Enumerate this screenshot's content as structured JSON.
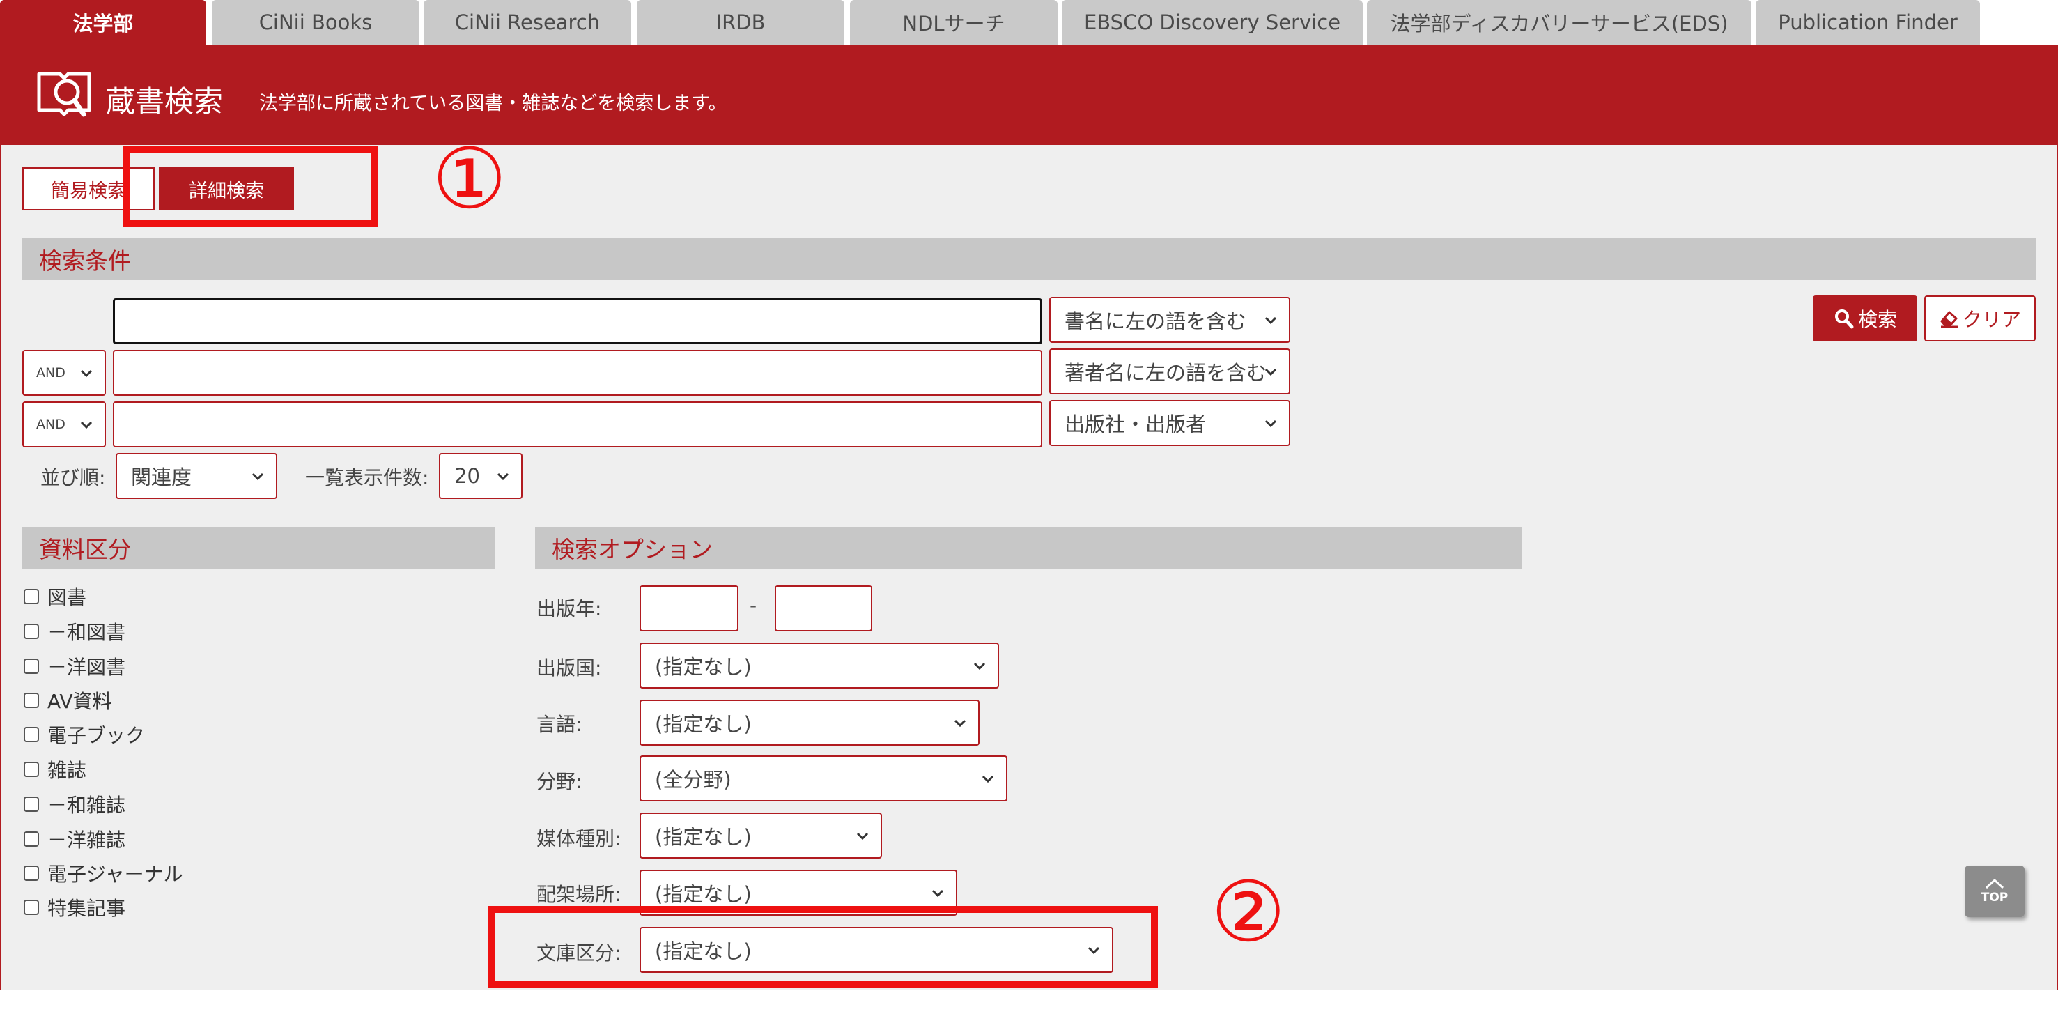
{
  "tabs": [
    {
      "label": "法学部",
      "active": true
    },
    {
      "label": "CiNii Books"
    },
    {
      "label": "CiNii Research"
    },
    {
      "label": "IRDB"
    },
    {
      "label": "NDLサーチ"
    },
    {
      "label": "EBSCO Discovery Service"
    },
    {
      "label": "法学部ディスカバリーサービス(EDS)"
    },
    {
      "label": "Publication Finder"
    }
  ],
  "header": {
    "title": "蔵書検索",
    "description": "法学部に所蔵されている図書・雑誌などを検索します。",
    "icon": "book-search-icon"
  },
  "mode": {
    "simple_label": "簡易検索",
    "detail_label": "詳細検索",
    "active": "detail"
  },
  "conditions": {
    "section_title": "検索条件",
    "rows": [
      {
        "value": "",
        "field": "書名に左の語を含む"
      },
      {
        "operator": "AND",
        "value": "",
        "field": "著者名に左の語を含む"
      },
      {
        "operator": "AND",
        "value": "",
        "field": "出版社・出版者"
      }
    ],
    "sort_label": "並び順:",
    "sort_value": "関連度",
    "per_page_label": "一覧表示件数:",
    "per_page_value": "20",
    "search_button": "検索",
    "clear_button": "クリア"
  },
  "material_types": {
    "section_title": "資料区分",
    "items": [
      {
        "label": "図書",
        "checked": false
      },
      {
        "label": "－和図書",
        "checked": false
      },
      {
        "label": "－洋図書",
        "checked": false
      },
      {
        "label": "AV資料",
        "checked": false
      },
      {
        "label": "電子ブック",
        "checked": false
      },
      {
        "label": "雑誌",
        "checked": false
      },
      {
        "label": "－和雑誌",
        "checked": false
      },
      {
        "label": "－洋雑誌",
        "checked": false
      },
      {
        "label": "電子ジャーナル",
        "checked": false
      },
      {
        "label": "特集記事",
        "checked": false
      }
    ]
  },
  "options": {
    "section_title": "検索オプション",
    "year_label": "出版年:",
    "year_from": "",
    "year_separator": "-",
    "year_to": "",
    "country_label": "出版国:",
    "country_value": "(指定なし)",
    "language_label": "言語:",
    "language_value": "(指定なし)",
    "field_label": "分野:",
    "field_value": "(全分野)",
    "media_label": "媒体種別:",
    "media_value": "(指定なし)",
    "location_label": "配架場所:",
    "location_value": "(指定なし)",
    "bunko_label": "文庫区分:",
    "bunko_value": "(指定なし)"
  },
  "annotations": {
    "marker_1": "①",
    "marker_2": "②",
    "color": "#ee1111"
  },
  "top_button": {
    "label": "TOP"
  },
  "colors": {
    "brand": "#b11b20",
    "tab_inactive": "#c9c9c9",
    "section_bar": "#c7c7c7",
    "body_bg": "#efefef"
  }
}
